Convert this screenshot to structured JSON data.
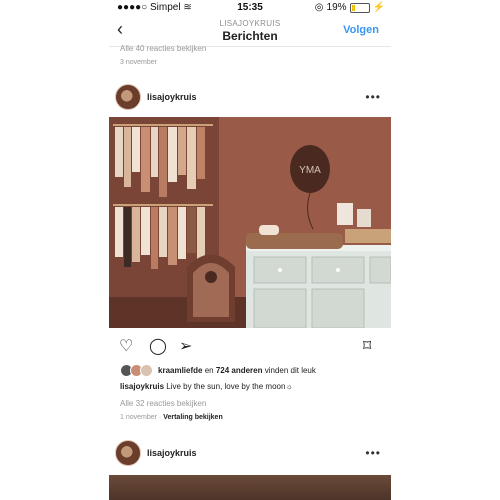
{
  "status": {
    "carrier": "Simpel",
    "time": "15:35",
    "battery": "19%"
  },
  "nav": {
    "back": "‹",
    "account": "LISAJOYKRUIS",
    "title": "Berichten",
    "follow": "Volgen"
  },
  "previous": {
    "comments": "Alle 40 reacties bekijken",
    "date": "3 november"
  },
  "post": {
    "username": "lisajoykruis",
    "photo_label": "YMA",
    "likes": {
      "first": "kraamliefde",
      "connector": " en ",
      "count": "724 anderen",
      "suffix": " vinden dit leuk"
    },
    "caption": {
      "user": "lisajoykruis",
      "text": " Live by the sun, love by the moon☼"
    },
    "comments": "Alle 32 reacties bekijken",
    "date": "1 november",
    "translate": "Vertaling bekijken"
  },
  "post2": {
    "username": "lisajoykruis"
  },
  "colors": {
    "accent": "#3897f0",
    "wall": "#9a5a48"
  },
  "icons": [
    "heart-icon",
    "comment-icon",
    "share-icon",
    "bookmark-icon",
    "more-icon",
    "back-icon",
    "wifi-icon",
    "battery-icon",
    "location-icon"
  ]
}
